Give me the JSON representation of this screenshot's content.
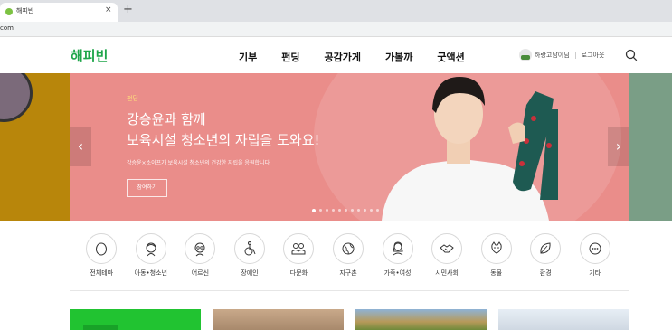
{
  "browser": {
    "tab_title": "해피빈",
    "tab_close": "×",
    "new_tab": "+",
    "url": "com"
  },
  "header": {
    "logo": "해피빈",
    "nav": [
      "기부",
      "펀딩",
      "공감가게",
      "가볼까",
      "굿액션"
    ],
    "user_name": "하랑고남이님",
    "logout": "로그아웃"
  },
  "banner": {
    "category": "펀딩",
    "title_line1": "강승윤과 함께",
    "title_line2": "보육시설 청소년의 자립을 도와요!",
    "subtitle": "강승윤×소이프가 보육시설 청소년의 건강한 자립을 응원합니다",
    "button": "참여하기",
    "prev": "‹",
    "next": "›",
    "slide_count": 11,
    "active_slide": 1
  },
  "categories": [
    {
      "label": "전체테마",
      "icon": "egg-icon"
    },
    {
      "label": "아동•청소년",
      "icon": "child-icon"
    },
    {
      "label": "어르신",
      "icon": "elder-icon"
    },
    {
      "label": "장애인",
      "icon": "wheelchair-icon"
    },
    {
      "label": "다문화",
      "icon": "people-icon"
    },
    {
      "label": "지구촌",
      "icon": "globe-icon"
    },
    {
      "label": "가족•여성",
      "icon": "woman-icon"
    },
    {
      "label": "시민사회",
      "icon": "handshake-icon"
    },
    {
      "label": "동물",
      "icon": "cat-icon"
    },
    {
      "label": "환경",
      "icon": "leaf-icon"
    },
    {
      "label": "기타",
      "icon": "more-icon"
    }
  ],
  "colors": {
    "brand": "#1fa64a",
    "banner_bg": "#ea8d8a",
    "banner_category": "#ffe27a"
  }
}
